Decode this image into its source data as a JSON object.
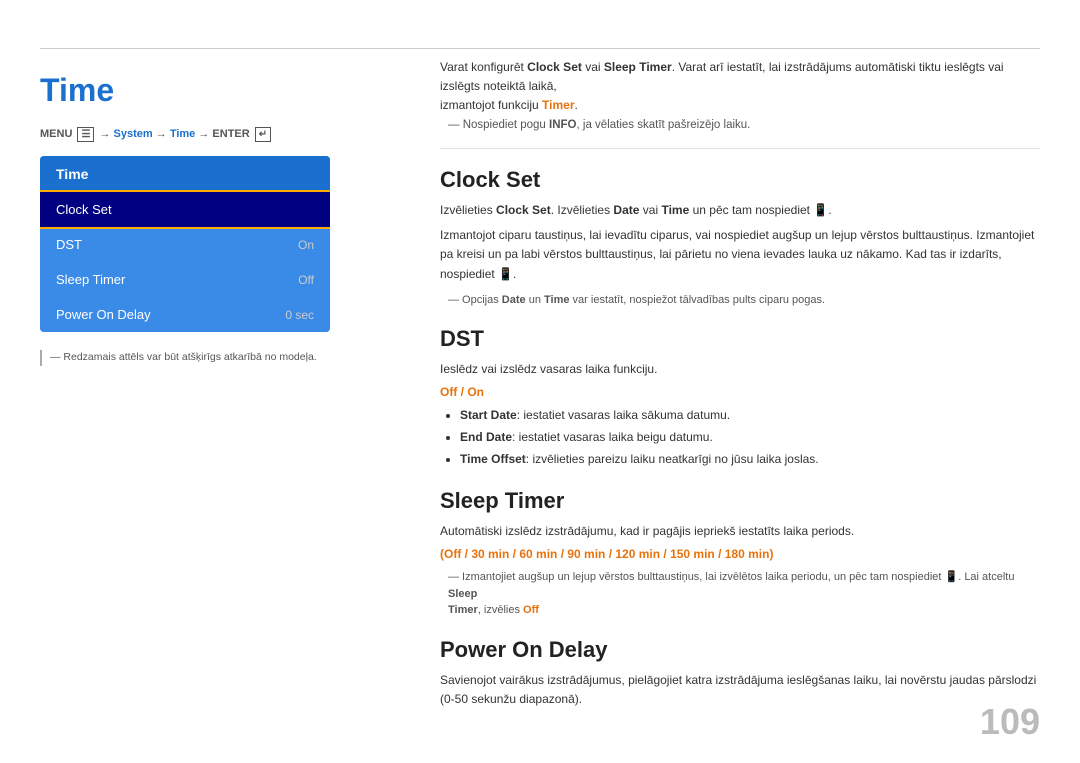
{
  "top_line": {},
  "left": {
    "title": "Time",
    "menu_path": "MENU  → System → Time → ENTER",
    "menu_path_parts": {
      "prefix": "MENU ",
      "item1": "System",
      "arrow1": " → ",
      "item2": "Time",
      "arrow2": " → ENTER "
    },
    "sidebar": {
      "header": "Time",
      "items": [
        {
          "label": "Clock Set",
          "value": "",
          "selected": true
        },
        {
          "label": "DST",
          "value": "On",
          "selected": false
        },
        {
          "label": "Sleep Timer",
          "value": "Off",
          "selected": false
        },
        {
          "label": "Power On Delay",
          "value": "0 sec",
          "selected": false
        }
      ]
    },
    "note": "— Redzamais attēls var būt atšķirīgs atkarībā no modeļa."
  },
  "right": {
    "intro": {
      "text": "Varat konfigurēt Clock Set vai Sleep Timer. Varat arī iestatīt, lai izstrādājums automātiski tiktu ieslēgts vai izslēgts noteiktā laikā, izmantojot funkciju Timer.",
      "strong_items": [
        "Clock Set",
        "Sleep Timer",
        "Timer"
      ],
      "note": "— Nospiediet pogu INFO, ja vēlaties skatīt pašreizējo laiku."
    },
    "sections": [
      {
        "id": "clock-set",
        "title": "Clock Set",
        "body": [
          "Izvēlieties Clock Set. Izvēlieties Date vai Time un pēc tam nospiediet.",
          "Izmantojot ciparu taustiņus, lai ievadītu ciparus, vai nospiediet augšup un lejup vērstos bulttaustiņus. Izmantojiet pa kreisi un pa labi vērstos bulttaustiņus, lai pārietu no viena ievades lauka uz nākamo. Kad tas ir izdarīts, nospiediet.",
          "— Opcijas Date un Time var iestatīt, nospiežot tālvadības pults ciparu pogas."
        ]
      },
      {
        "id": "dst",
        "title": "DST",
        "body": "Ieslēdz vai izslēdz vasaras laika funkciju.",
        "options_label": "Off / On",
        "bullets": [
          "Start Date: iestatiet vasaras laika sākuma datumu.",
          "End Date: iestatiet vasaras laika beigu datumu.",
          "Time Offset: izvēlieties pareizu laiku neatkarīgi no jūsu laika joslas."
        ]
      },
      {
        "id": "sleep-timer",
        "title": "Sleep Timer",
        "body": "Automātiski izslēdz izstrādājumu, kad ir pagājis iepriekš iestatīts laika periods.",
        "options_label": "(Off / 30 min / 60 min / 90 min / 120 min / 150 min / 180 min)",
        "note": "— Izmantojiet augšup un lejup vērstos bulttaustiņus, lai izvēlētos laika periodu, un pēc tam nospiediet. Lai atceltu Sleep Timer, izvēlies Off"
      },
      {
        "id": "power-on-delay",
        "title": "Power On Delay",
        "body": "Savienojot vairākus izstrādājumus, pielāgojiet katra izstrādājuma ieslēgšanas laiku, lai novērstu jaudas pārslodzi (0-50 sekunžu diapazonā)."
      }
    ]
  },
  "page_number": "109"
}
